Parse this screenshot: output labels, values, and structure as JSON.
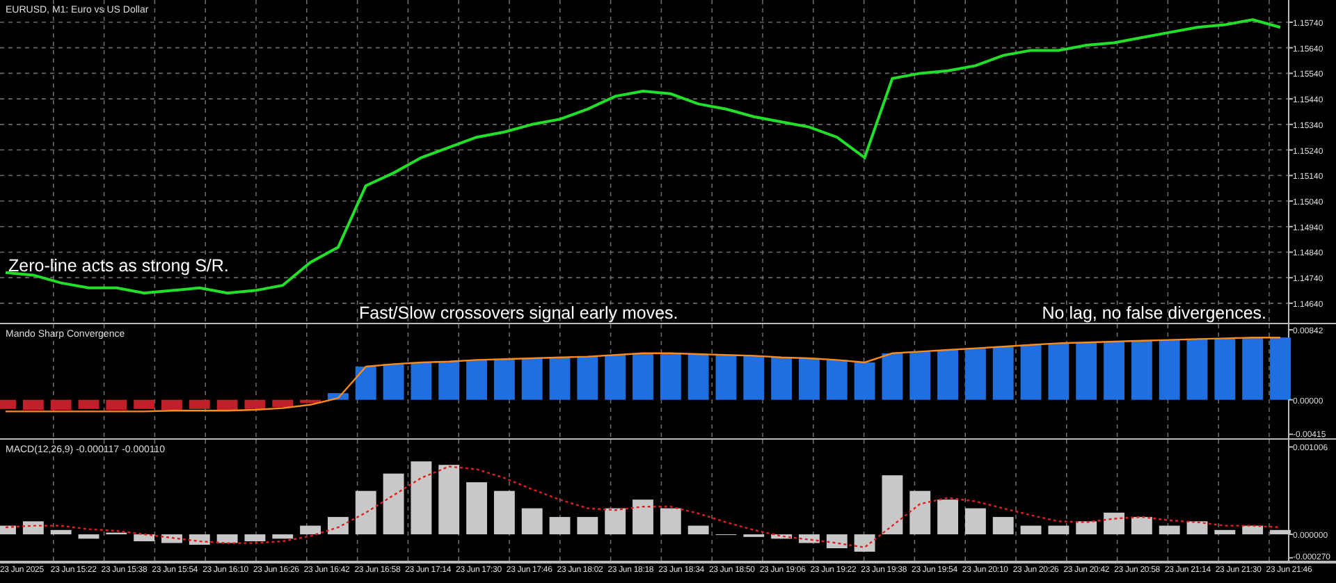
{
  "price_panel": {
    "title": "EURUSD, M1:  Euro vs US Dollar",
    "chart_data": {
      "type": "line",
      "ylim": [
        1.14558,
        1.15827
      ],
      "yticks": [
        {
          "value": 1.1574,
          "label": "1.15740"
        },
        {
          "value": 1.1564,
          "label": "1.15640"
        },
        {
          "value": 1.1554,
          "label": "1.15540"
        },
        {
          "value": 1.1544,
          "label": "1.15440"
        },
        {
          "value": 1.1534,
          "label": "1.15340"
        },
        {
          "value": 1.1524,
          "label": "1.15240"
        },
        {
          "value": 1.1514,
          "label": "1.15140"
        },
        {
          "value": 1.1504,
          "label": "1.15040"
        },
        {
          "value": 1.1494,
          "label": "1.14940"
        },
        {
          "value": 1.1484,
          "label": "1.14840"
        },
        {
          "value": 1.1474,
          "label": "1.14740"
        },
        {
          "value": 1.1464,
          "label": "1.14640"
        }
      ],
      "series": [
        {
          "type": "line",
          "color": "#22e02a",
          "values": [
            1.1476,
            1.1475,
            1.1472,
            1.147,
            1.147,
            1.1468,
            1.1469,
            1.147,
            1.1468,
            1.1469,
            1.1471,
            1.148,
            1.1486,
            1.151,
            1.1515,
            1.1521,
            1.1525,
            1.1529,
            1.1531,
            1.1534,
            1.1536,
            1.154,
            1.1545,
            1.1547,
            1.1546,
            1.1542,
            1.154,
            1.1537,
            1.1535,
            1.1533,
            1.1529,
            1.1521,
            1.1552,
            1.1554,
            1.1555,
            1.1557,
            1.1561,
            1.1563,
            1.1563,
            1.1565,
            1.1566,
            1.1568,
            1.157,
            1.1572,
            1.1573,
            1.1575,
            1.1572
          ]
        }
      ],
      "grid": true
    },
    "notes": [
      "Zero-line acts as strong S/R.",
      "Fast/Slow crossovers signal early moves.",
      "No lag, no false divergences."
    ]
  },
  "msc_panel": {
    "title": "Mando Sharp Convergence",
    "chart_data": {
      "type": "bar",
      "ylim": [
        -0.0048,
        0.0091
      ],
      "grid": true,
      "yticks": [
        {
          "value": 0.00842,
          "label": "0.00842"
        },
        {
          "value": 0,
          "label": "0.00000"
        },
        {
          "value": -0.00415,
          "label": "-0.00415"
        }
      ],
      "series": [
        {
          "type": "bar",
          "color": "#c0202a",
          "values": [
            -0.0011,
            -0.0012,
            -0.0012,
            -0.0011,
            -0.0012,
            -0.0011,
            -0.0012,
            -0.0011,
            -0.0012,
            -0.0011,
            -0.0009,
            -0.0004,
            null,
            null,
            null,
            null,
            null,
            null,
            null,
            null,
            null,
            null,
            null,
            null,
            null,
            null,
            null,
            null,
            null,
            null,
            null,
            null,
            null,
            null,
            null,
            null,
            null,
            null,
            null,
            null,
            null,
            null,
            null,
            null,
            null,
            null,
            null
          ]
        },
        {
          "type": "bar",
          "color": "#1f6fe0",
          "values": [
            null,
            null,
            null,
            null,
            null,
            null,
            null,
            null,
            null,
            null,
            null,
            null,
            0.0008,
            0.004,
            0.0043,
            0.0045,
            0.0046,
            0.0048,
            0.0049,
            0.005,
            0.0051,
            0.0052,
            0.0054,
            0.0056,
            0.0056,
            0.0055,
            0.0054,
            0.0053,
            0.0051,
            0.005,
            0.0048,
            0.0045,
            0.0056,
            0.0058,
            0.006,
            0.0062,
            0.0064,
            0.0066,
            0.0068,
            0.0069,
            0.007,
            0.0071,
            0.0072,
            0.0073,
            0.0074,
            0.0075,
            0.0075
          ]
        },
        {
          "type": "line",
          "color": "#ff8c1a",
          "values": [
            -0.0014,
            -0.0014,
            -0.0014,
            -0.0014,
            -0.0014,
            -0.0014,
            -0.0013,
            -0.0013,
            -0.0013,
            -0.0012,
            -0.001,
            -0.0006,
            0.0002,
            0.004,
            0.0043,
            0.0045,
            0.0046,
            0.0048,
            0.0049,
            0.005,
            0.0051,
            0.0052,
            0.0054,
            0.0056,
            0.0056,
            0.0055,
            0.0054,
            0.0053,
            0.0051,
            0.005,
            0.0048,
            0.0045,
            0.0056,
            0.0058,
            0.006,
            0.0062,
            0.0064,
            0.0066,
            0.0068,
            0.0069,
            0.007,
            0.0071,
            0.0072,
            0.0073,
            0.0074,
            0.0075,
            0.0075
          ]
        }
      ]
    }
  },
  "macd_panel": {
    "title": "MACD(12,26,9) -0.000117 -0.000110",
    "chart_data": {
      "type": "bar",
      "ylim": [
        -0.00032,
        0.00109
      ],
      "grid": true,
      "yticks": [
        {
          "value": 0.001006,
          "label": "0.001006"
        },
        {
          "value": 0,
          "label": "0.000000"
        },
        {
          "value": -0.00027,
          "label": "-0.000270"
        }
      ],
      "series": [
        {
          "type": "bar",
          "color": "#c8c8c8",
          "values": [
            0.0001,
            0.00015,
            5e-05,
            -5e-05,
            2e-05,
            -8e-05,
            -0.0001,
            -0.00012,
            -0.0001,
            -8e-05,
            -5e-05,
            0.0001,
            0.0002,
            0.0005,
            0.0007,
            0.00084,
            0.0008,
            0.0006,
            0.0005,
            0.0003,
            0.0002,
            0.0002,
            0.0003,
            0.0004,
            0.0003,
            0.0001,
            0.0,
            -3e-05,
            -5e-05,
            -0.0001,
            -0.00016,
            -0.0002,
            0.00068,
            0.0005,
            0.0004,
            0.0003,
            0.0002,
            0.0001,
            0.0001,
            0.00015,
            0.00025,
            0.0002,
            0.0001,
            0.00015,
            5e-05,
            0.0001,
            5e-05
          ]
        },
        {
          "type": "line",
          "line_style": "dashed",
          "color": "#e02020",
          "values": [
            8e-05,
            0.0001,
            0.0001,
            6e-05,
            4e-05,
            0.0,
            -4e-05,
            -8e-05,
            -0.0001,
            -0.0001,
            -8e-05,
            -2e-05,
            8e-05,
            0.00025,
            0.00045,
            0.00065,
            0.00078,
            0.00075,
            0.00065,
            0.00052,
            0.0004,
            0.0003,
            0.00028,
            0.00032,
            0.00032,
            0.00024,
            0.00014,
            5e-05,
            -2e-05,
            -6e-05,
            -0.0001,
            -0.00015,
            0.0001,
            0.00035,
            0.00042,
            0.00038,
            0.0003,
            0.00022,
            0.00015,
            0.00014,
            0.00018,
            0.0002,
            0.00016,
            0.00014,
            0.0001,
            0.0001,
            8e-05
          ]
        }
      ]
    }
  },
  "time_axis": {
    "labels": [
      "23 Jun 2025",
      "23 Jun 15:22",
      "23 Jun 15:38",
      "23 Jun 15:54",
      "23 Jun 16:10",
      "23 Jun 16:26",
      "23 Jun 16:42",
      "23 Jun 16:58",
      "23 Jun 17:14",
      "23 Jun 17:30",
      "23 Jun 17:46",
      "23 Jun 18:02",
      "23 Jun 18:18",
      "23 Jun 18:34",
      "23 Jun 18:50",
      "23 Jun 19:06",
      "23 Jun 19:22",
      "23 Jun 19:38",
      "23 Jun 19:54",
      "23 Jun 20:10",
      "23 Jun 20:26",
      "23 Jun 20:42",
      "23 Jun 20:58",
      "23 Jun 21:14",
      "23 Jun 21:30",
      "23 Jun 21:46"
    ]
  }
}
